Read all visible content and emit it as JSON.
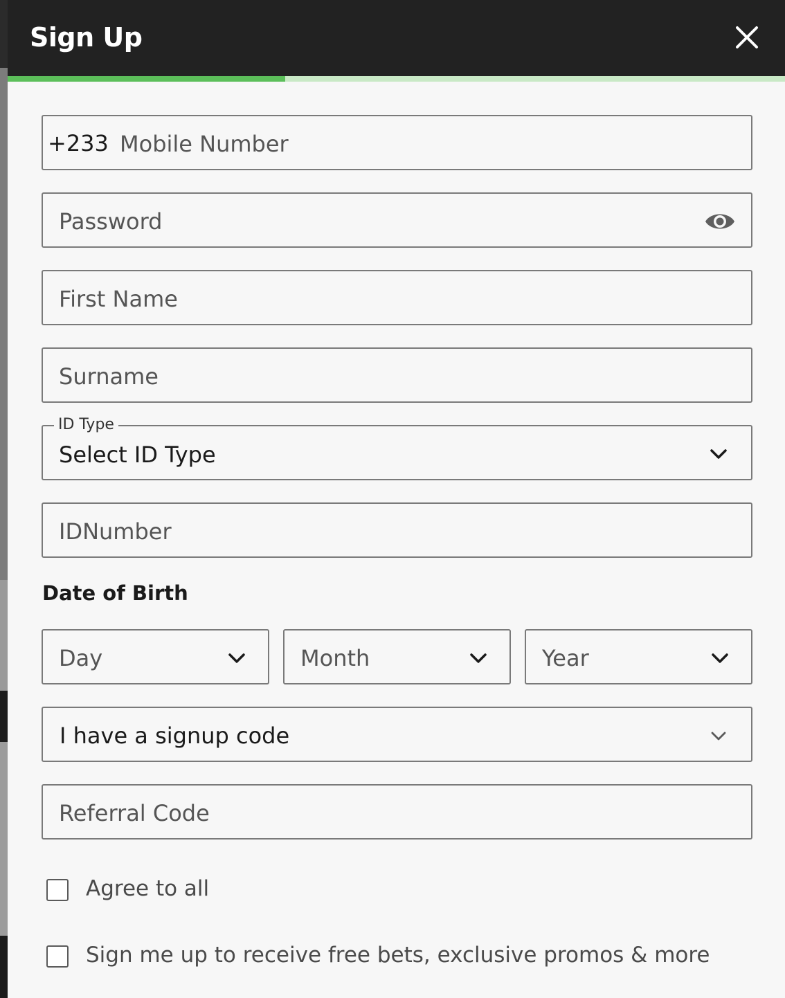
{
  "header": {
    "title": "Sign Up"
  },
  "progress": {
    "fraction": 0.357
  },
  "form": {
    "mobile": {
      "prefix": "+233",
      "placeholder": "Mobile Number"
    },
    "password": {
      "placeholder": "Password"
    },
    "first_name": {
      "placeholder": "First Name"
    },
    "surname": {
      "placeholder": "Surname"
    },
    "id_type": {
      "label": "ID Type",
      "value": "Select ID Type"
    },
    "id_number": {
      "placeholder": "IDNumber"
    },
    "dob": {
      "label": "Date of Birth",
      "day": "Day",
      "month": "Month",
      "year": "Year"
    },
    "signup_code": {
      "value": "I have a signup code"
    },
    "referral": {
      "placeholder": "Referral Code"
    },
    "agree_all": {
      "label": "Agree to all",
      "checked": false
    },
    "promos": {
      "label": "Sign me up to receive free bets, exclusive promos & more",
      "checked": false
    }
  },
  "colors": {
    "header_bg": "#222222",
    "progress_fill": "#5cbf5a",
    "progress_track": "#c9e9c6",
    "border": "#7a7a7a"
  },
  "icons": [
    "close-icon",
    "eye-icon",
    "chevron-down-icon",
    "checkbox-icon"
  ]
}
